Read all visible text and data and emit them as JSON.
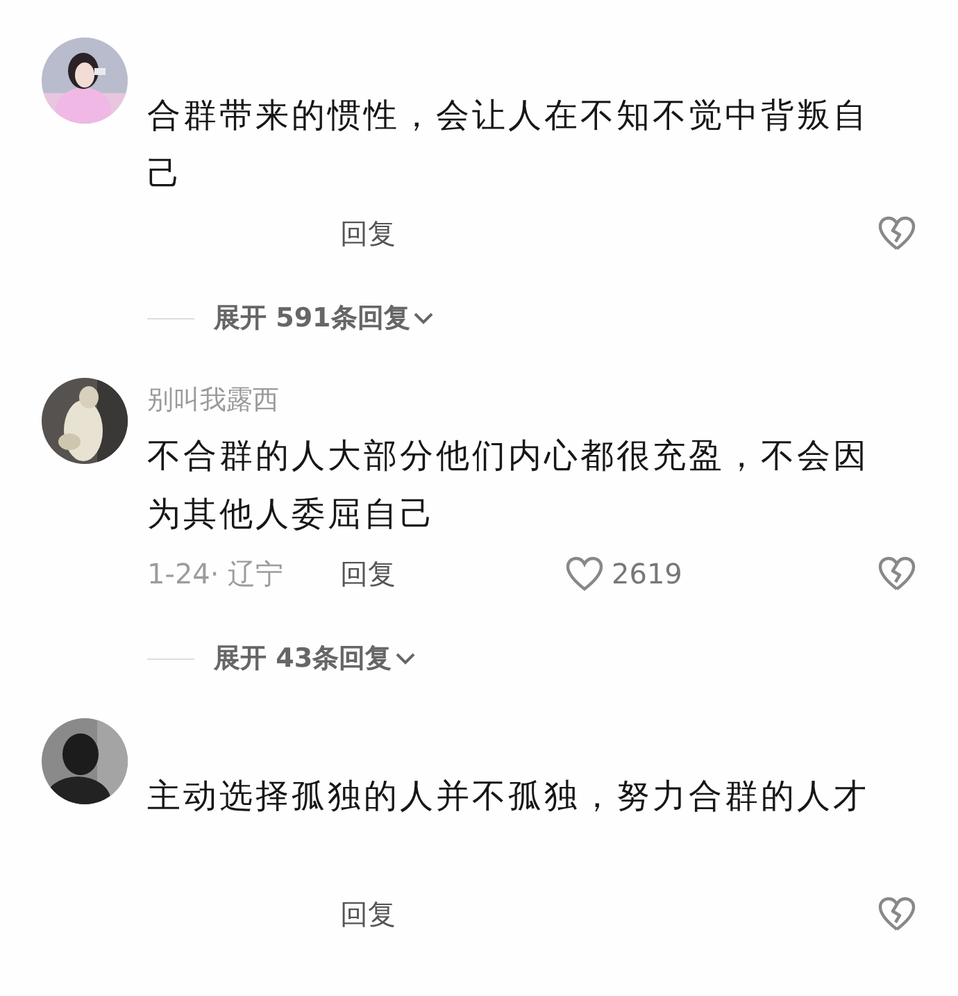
{
  "comments": [
    {
      "body": "合群带来的惯性，会让人在不知不觉中背叛自己",
      "reply": "回复",
      "expand": "展开 591条回复"
    },
    {
      "username": "别叫我露西",
      "body": "不合群的人大部分他们内心都很充盈，不会因为其他人委屈自己",
      "meta": "1-24· 辽宁",
      "reply": "回复",
      "likes": "2619",
      "expand": "展开 43条回复"
    },
    {
      "body": "主动选择孤独的人并不孤独，努力合群的人才",
      "reply": "回复"
    }
  ]
}
